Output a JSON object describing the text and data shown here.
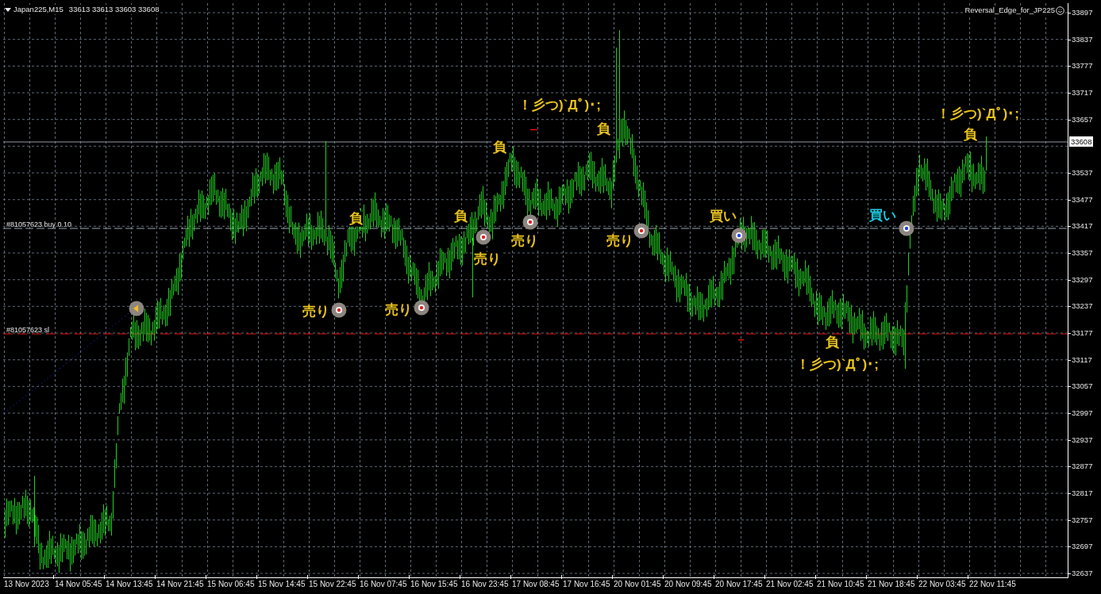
{
  "header": {
    "symbol": "Japan225,M15",
    "quotes": "33613 33613 33603 33608"
  },
  "indicator": {
    "name": "Reversal_Edge_for_JP225"
  },
  "price_axis": {
    "labels": [
      "33897",
      "33837",
      "33777",
      "33717",
      "33657",
      "33537",
      "33477",
      "33417",
      "33357",
      "33297",
      "33237",
      "33177",
      "33117",
      "33057",
      "32997",
      "32937",
      "32877",
      "32817",
      "32757",
      "32697",
      "32637"
    ],
    "current_price": "33608"
  },
  "time_axis": {
    "labels": [
      "13 Nov 2023",
      "14 Nov 05:45",
      "14 Nov 13:45",
      "14 Nov 21:45",
      "15 Nov 06:45",
      "15 Nov 14:45",
      "15 Nov 22:45",
      "16 Nov 07:45",
      "16 Nov 15:45",
      "16 Nov 23:45",
      "17 Nov 08:45",
      "17 Nov 16:45",
      "20 Nov 01:45",
      "20 Nov 09:45",
      "20 Nov 17:45",
      "21 Nov 02:45",
      "21 Nov 10:45",
      "21 Nov 18:45",
      "22 Nov 03:45",
      "22 Nov 11:45"
    ]
  },
  "order_lines": [
    {
      "label": "#81057623 buy 0.10",
      "kind": "entry"
    },
    {
      "label": "#81057623 sl",
      "kind": "stop"
    }
  ],
  "markers": [
    {
      "kind": "arrow"
    },
    {
      "kind": "sell"
    },
    {
      "kind": "sell"
    },
    {
      "kind": "sell"
    },
    {
      "kind": "sell"
    },
    {
      "kind": "sell"
    },
    {
      "kind": "buy"
    },
    {
      "kind": "buy"
    }
  ],
  "annotations": [
    {
      "text": "売り",
      "color": "#e8c21c"
    },
    {
      "text": "売り",
      "color": "#e8c21c"
    },
    {
      "text": "負",
      "color": "#e8c21c"
    },
    {
      "text": "負",
      "color": "#e8c21c"
    },
    {
      "text": "売り",
      "color": "#e8c21c"
    },
    {
      "text": "売り",
      "color": "#e8c21c"
    },
    {
      "text": "負",
      "color": "#e8c21c"
    },
    {
      "text": "！彡つ)`Дﾟ)･;",
      "color": "#e8c21c"
    },
    {
      "text": "負",
      "color": "#e8c21c"
    },
    {
      "text": "売り",
      "color": "#e8c21c"
    },
    {
      "text": "買い",
      "color": "#e8c21c"
    },
    {
      "text": "買い",
      "color": "#1ec8e0"
    },
    {
      "text": "負",
      "color": "#e8c21c"
    },
    {
      "text": "！彡つ)`Дﾟ)･;",
      "color": "#e8c21c"
    },
    {
      "text": "！彡つ)`Дﾟ)･;",
      "color": "#e8c21c"
    },
    {
      "text": "負",
      "color": "#e8c21c"
    }
  ]
}
